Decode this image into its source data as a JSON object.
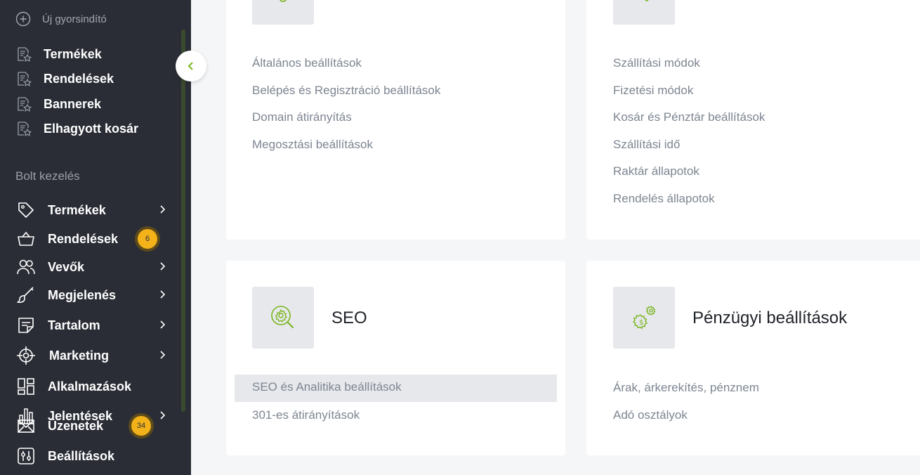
{
  "sidebar": {
    "new_shortcut": "Új gyorsindító",
    "shortcuts": [
      "Termékek",
      "Rendelések",
      "Bannerek",
      "Elhagyott kosár"
    ],
    "section_title": "Bolt kezelés",
    "nav": {
      "termekek": "Termékek",
      "rendelesek": "Rendelések",
      "rendelesek_badge": "6",
      "vevok": "Vevők",
      "megjelenes": "Megjelenés",
      "tartalom": "Tartalom",
      "marketing": "Marketing",
      "alkalmazasok": "Alkalmazások",
      "jelentesek": "Jelentések",
      "uzenetek": "Üzenetek",
      "uzenetek_badge": "34",
      "beallitasok": "Beállítások"
    }
  },
  "cards": {
    "general": {
      "links": [
        "Általános beállítások",
        "Belépés és Regisztráció beállítások",
        "Domain átirányítás",
        "Megosztási beállítások"
      ]
    },
    "shipping": {
      "links": [
        "Szállítási módok",
        "Fizetési módok",
        "Kosár és Pénztár beállítások",
        "Szállítási idő",
        "Raktár állapotok",
        "Rendelés állapotok"
      ]
    },
    "seo": {
      "title": "SEO",
      "links": [
        "SEO és Analitika beállítások",
        "301-es átirányítások"
      ]
    },
    "finance": {
      "title": "Pénzügyi beállítások",
      "links": [
        "Árak, árkerekítés, pénznem",
        "Adó osztályok"
      ]
    }
  },
  "colors": {
    "sidebar_bg": "#2a2d35",
    "accent_green": "#7ab51d",
    "badge": "#f3b21a",
    "link": "#7d8591"
  }
}
